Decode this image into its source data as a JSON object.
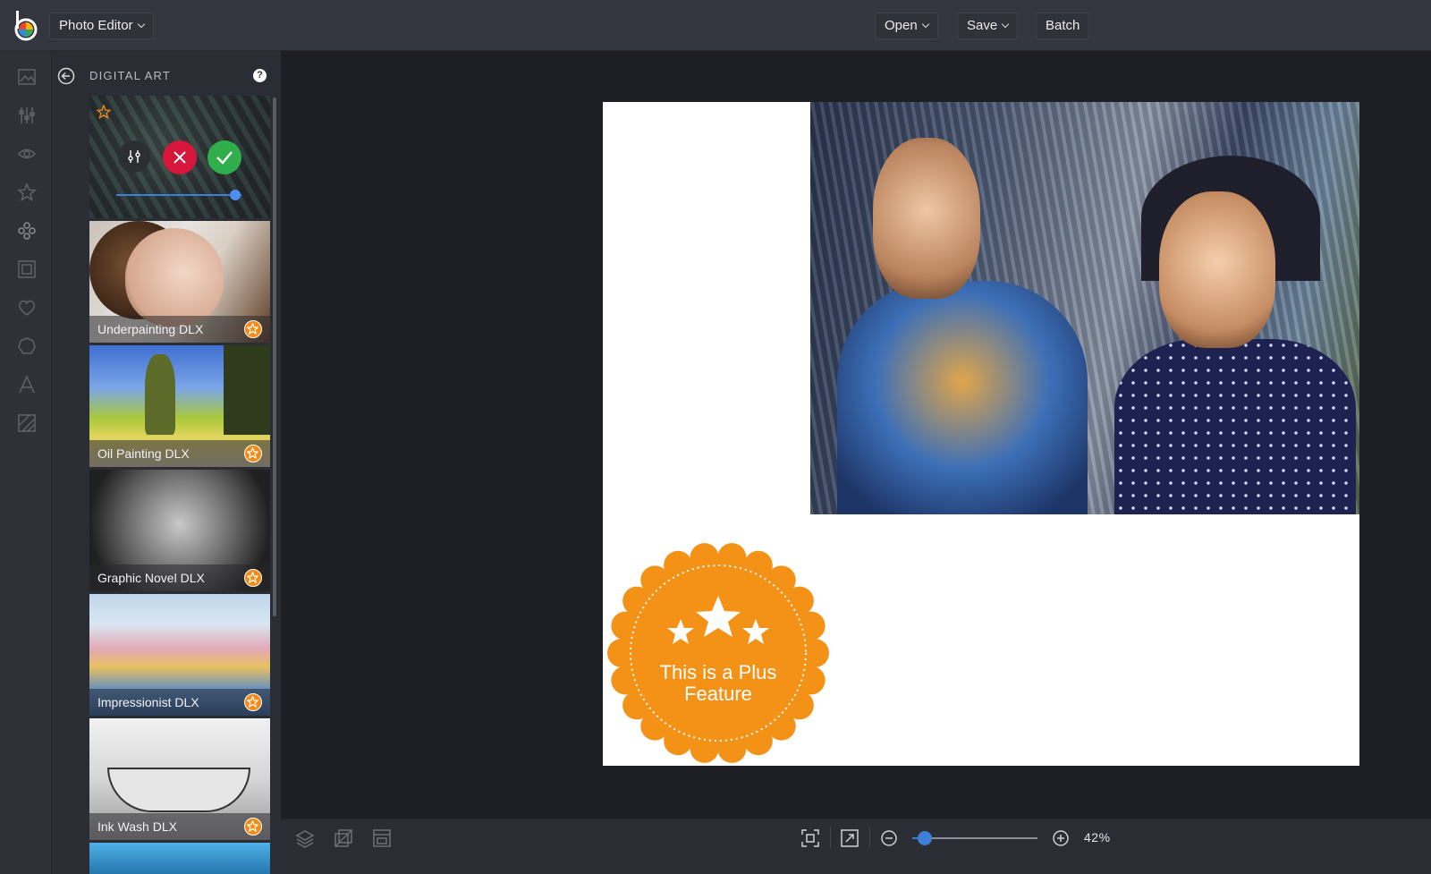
{
  "header": {
    "app_menu_label": "Photo Editor",
    "open_label": "Open",
    "save_label": "Save",
    "batch_label": "Batch"
  },
  "rail": {
    "icons": [
      "image-icon",
      "sliders-icon",
      "eye-icon",
      "star-icon",
      "effects-icon",
      "frame-icon",
      "heart-icon",
      "shape-icon",
      "text-icon",
      "texture-icon"
    ]
  },
  "panel": {
    "title": "DIGITAL ART",
    "help_label": "?",
    "effects": [
      {
        "label": "Underpainting DLX",
        "plus": true
      },
      {
        "label": "Oil Painting DLX",
        "plus": true
      },
      {
        "label": "Graphic Novel DLX",
        "plus": true
      },
      {
        "label": "Impressionist DLX",
        "plus": true
      },
      {
        "label": "Ink Wash DLX",
        "plus": true
      }
    ],
    "active_effect": {
      "intensity": 0.95
    }
  },
  "canvas": {
    "plus_feature_line1": "This is a Plus",
    "plus_feature_line2": "Feature"
  },
  "footer": {
    "zoom_value": "42%",
    "zoom_fraction": 0.1
  },
  "colors": {
    "accent_blue": "#3d7ed6",
    "plus_orange": "#f38b16",
    "cancel_red": "#d6163a",
    "apply_green": "#2fae4b"
  }
}
